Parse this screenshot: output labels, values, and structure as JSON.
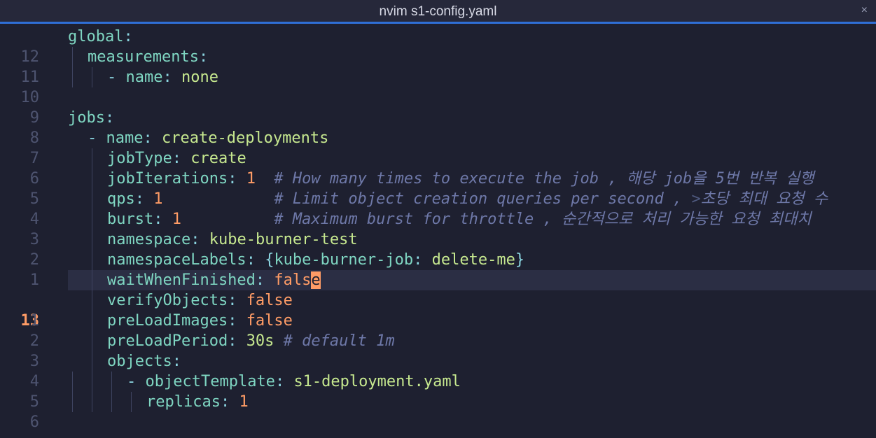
{
  "window": {
    "title": "nvim s1-config.yaml",
    "close_label": "×"
  },
  "lines": [
    {
      "num": "12",
      "c1": "global",
      "c2": ":"
    },
    {
      "num": "11",
      "c1": "measurements",
      "c2": ":"
    },
    {
      "num": "10",
      "dash": "- ",
      "c1": "name",
      "c2": ": ",
      "c3": "none"
    },
    {
      "num": "9"
    },
    {
      "num": "8",
      "c1": "jobs",
      "c2": ":"
    },
    {
      "num": "7",
      "dash": "- ",
      "c1": "name",
      "c2": ": ",
      "c3": "create-deployments"
    },
    {
      "num": "6",
      "c1": "jobType",
      "c2": ": ",
      "c3": "create"
    },
    {
      "num": "5",
      "c1": "jobIterations",
      "c2": ": ",
      "c3": "1",
      "comment": "  # How many times to execute the job , 해당 job을 5번 반복 실행"
    },
    {
      "num": "4",
      "c1": "qps",
      "c2": ": ",
      "c3": "1",
      "comment": "            # Limit object creation queries per second , ",
      "comment_dim": ">",
      "comment2": "초당 최대 요청 수"
    },
    {
      "num": "3",
      "c1": "burst",
      "c2": ": ",
      "c3": "1",
      "comment": "          # Maximum burst for throttle , 순간적으로 처리 가능한 요청 최대치"
    },
    {
      "num": "2",
      "c1": "namespace",
      "c2": ": ",
      "c3": "kube-burner-test"
    },
    {
      "num": "1",
      "c1": "namespaceLabels",
      "c2": ": ",
      "brace_open": "{",
      "c3": "kube-burner-job",
      "c4": ": ",
      "c5": "delete-me",
      "brace_close": "}"
    },
    {
      "num": "13",
      "c1": "waitWhenFinished",
      "c2": ": ",
      "c3": "fals",
      "cursor_char": "e"
    },
    {
      "num": "1",
      "c1": "verifyObjects",
      "c2": ": ",
      "c3": "false"
    },
    {
      "num": "2",
      "c1": "preLoadImages",
      "c2": ": ",
      "c3": "false"
    },
    {
      "num": "3",
      "c1": "preLoadPeriod",
      "c2": ": ",
      "c3": "30s",
      "comment": " # default 1m"
    },
    {
      "num": "4",
      "c1": "objects",
      "c2": ":"
    },
    {
      "num": "5",
      "dash": "- ",
      "c1": "objectTemplate",
      "c2": ": ",
      "c3": "s1-deployment.yaml"
    },
    {
      "num": "6",
      "c1": "replicas",
      "c2": ": ",
      "c3": "1"
    }
  ],
  "colors": {
    "background": "#1e2030",
    "accent": "#2f6fd6",
    "key": "#7fd6c2",
    "string": "#c6e88f",
    "number": "#ff9c66",
    "comment": "#6e78a8"
  }
}
